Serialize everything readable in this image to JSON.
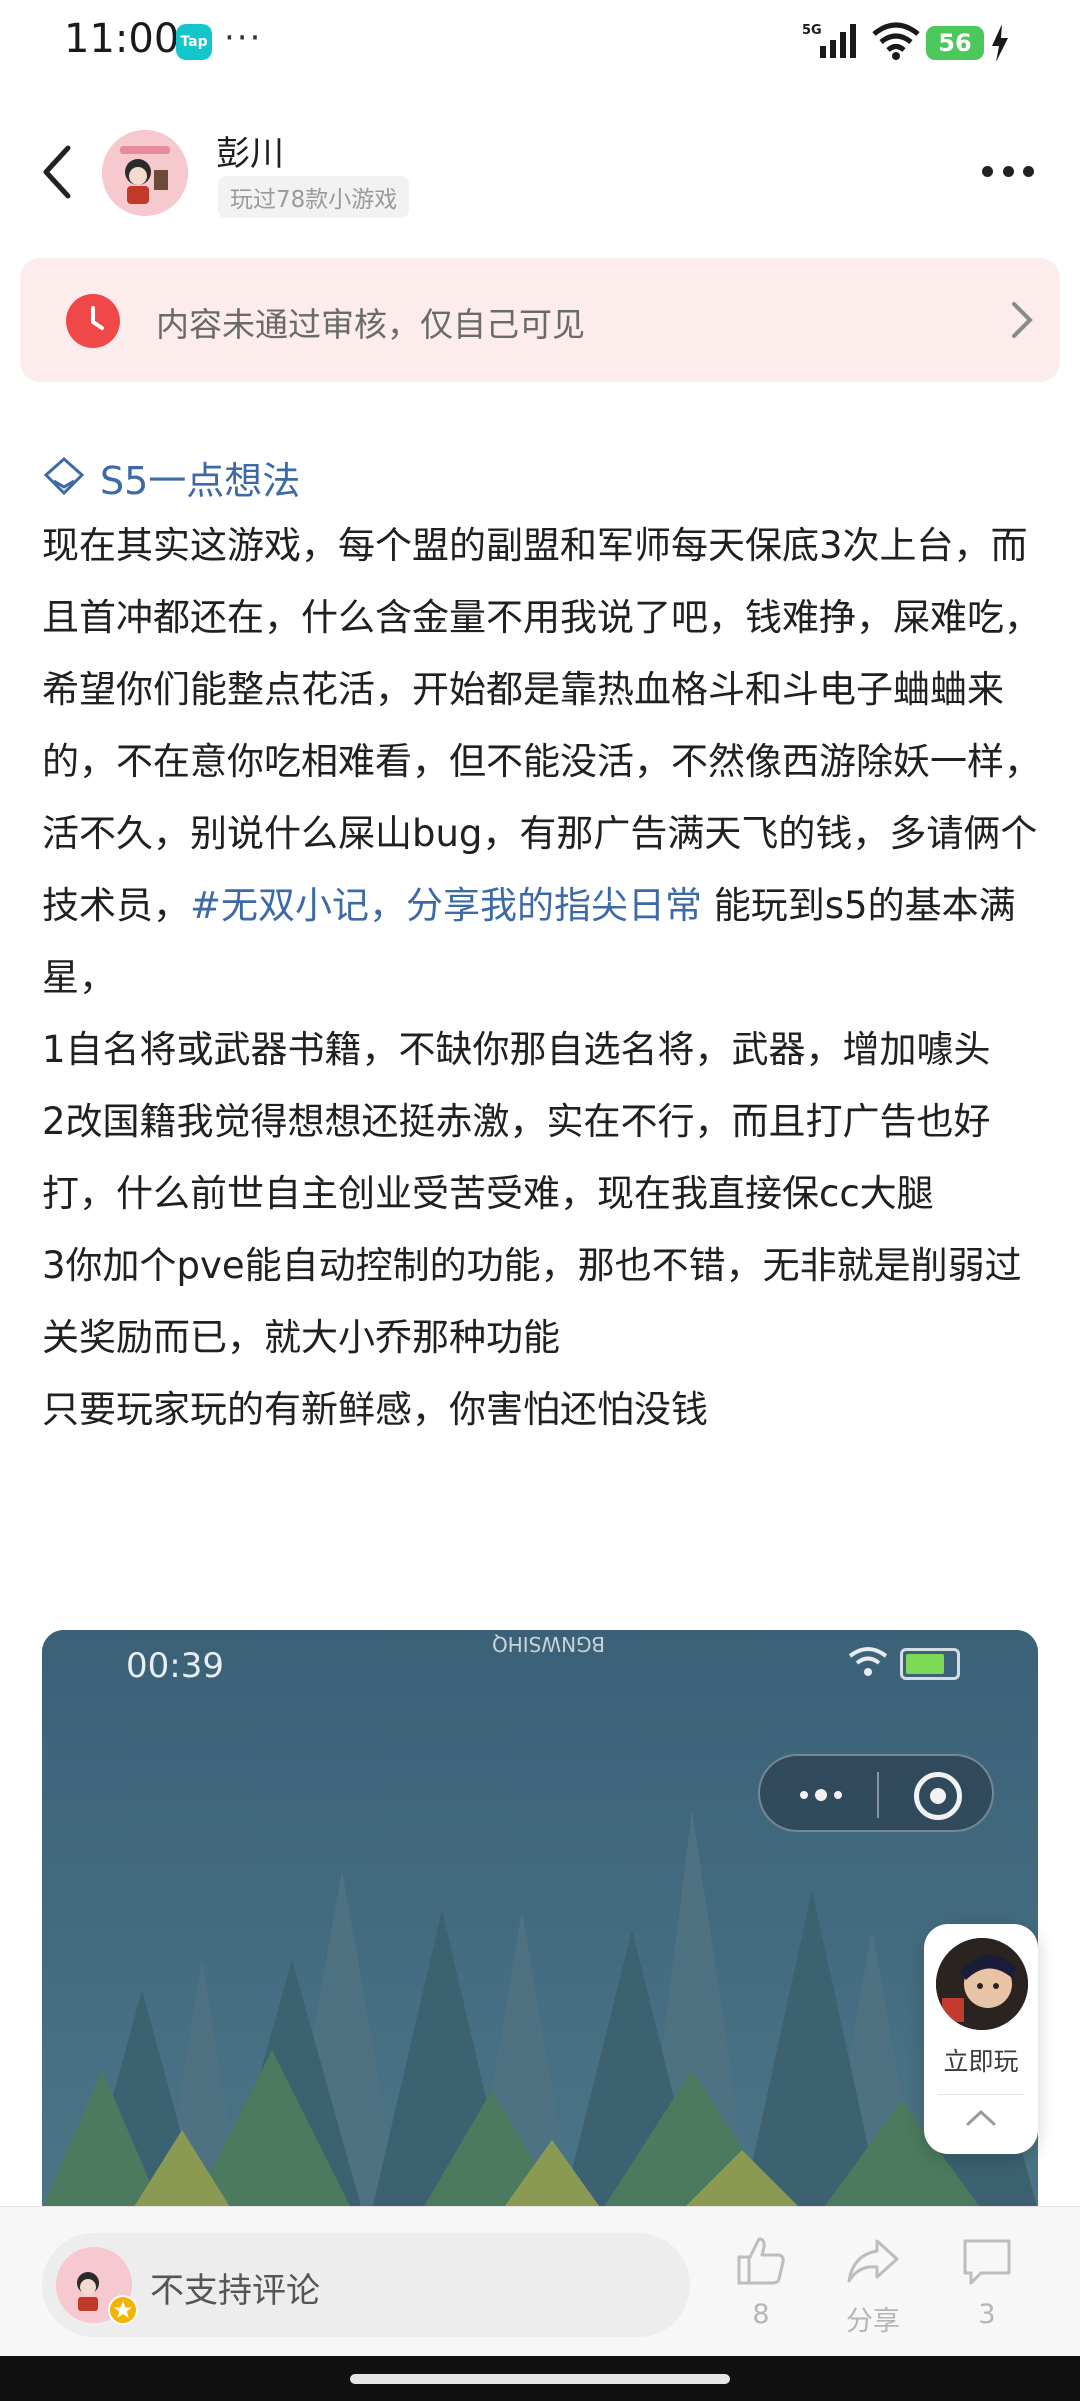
{
  "status_bar": {
    "time": "11:00",
    "app_badge": "Tap",
    "more": "···",
    "network": "5G",
    "battery": "56"
  },
  "header": {
    "username": "彭川",
    "played_tag": "玩过78款小游戏"
  },
  "notice": {
    "text": "内容未通过审核，仅自己可见"
  },
  "post": {
    "title": "S5一点想法",
    "body_part1": "现在其实这游戏，每个盟的副盟和军师每天保底3次上台，而且首冲都还在，什么含金量不用我说了吧，钱难挣，屎难吃，希望你们能整点花活，开始都是靠热血格斗和斗电子蛐蛐来的，不在意你吃相难看，但不能没活，不然像西游除妖一样，活不久，别说什么屎山bug，有那广告满天飞的钱，多请俩个技术员，",
    "hashtag": "#无双小记，分享我的指尖日常",
    "body_part2": " 能玩到s5的基本满星，\n1自名将或武器书籍，不缺你那自选名将，武器，增加噱头\n2改国籍我觉得想想还挺赤激，实在不行，而且打广告也好打，什么前世自主创业受苦受难，现在我直接保cc大腿\n3你加个pve能自动控制的功能，那也不错，无非就是削弱过关奖励而已，就大小乔那种功能\n只要玩家玩的有新鲜感，你害怕还怕没钱"
  },
  "video": {
    "time": "00:39",
    "watermark": "BGNWSIHQ"
  },
  "float_play": {
    "label": "立即玩"
  },
  "bottom_bar": {
    "comment_placeholder": "不支持评论",
    "like_count": "8",
    "share_label": "分享",
    "comment_count": "3"
  },
  "colors": {
    "accent_blue": "#3d6aa6",
    "notice_bg": "#fdecec",
    "notice_icon": "#f04848"
  }
}
